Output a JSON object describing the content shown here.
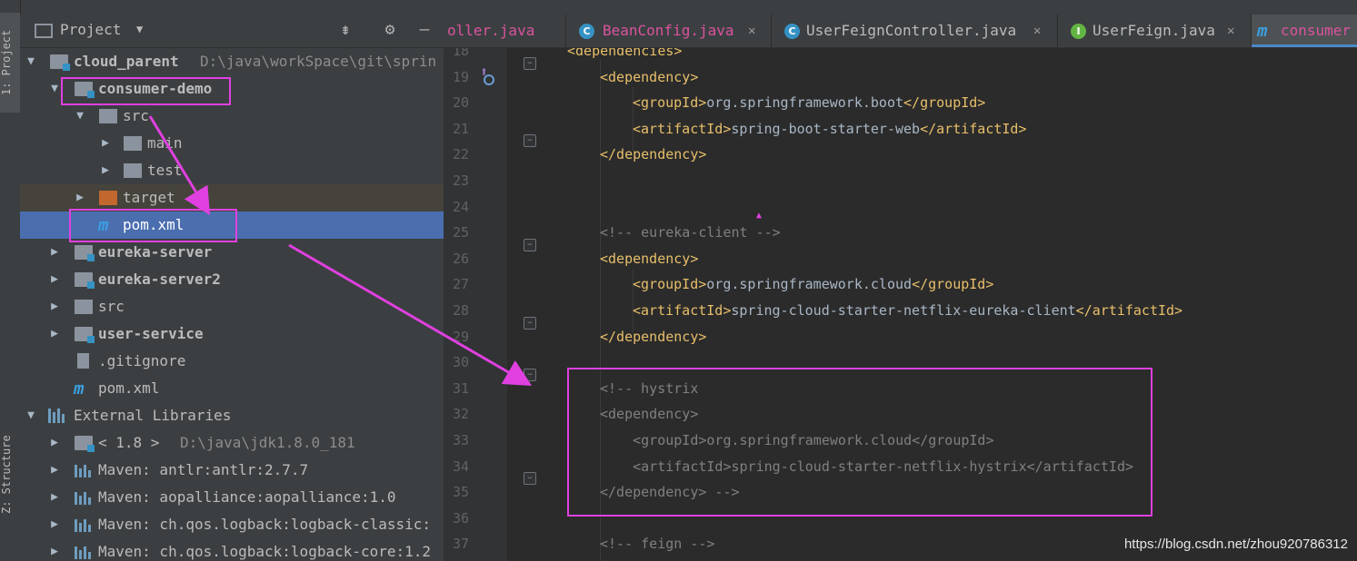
{
  "sidebar": {
    "project_tab": "1: Project",
    "structure_tab": "Z: Structure"
  },
  "project_panel": {
    "title": "Project",
    "tree": [
      {
        "label": "cloud_parent",
        "path": "D:\\java\\workSpace\\git\\sprin",
        "expanded": true
      },
      {
        "label": "consumer-demo",
        "expanded": true
      },
      {
        "label": "src",
        "expanded": true
      },
      {
        "label": "main"
      },
      {
        "label": "test"
      },
      {
        "label": "target"
      },
      {
        "label": "pom.xml"
      },
      {
        "label": "eureka-server"
      },
      {
        "label": "eureka-server2"
      },
      {
        "label": "src"
      },
      {
        "label": "user-service"
      },
      {
        "label": ".gitignore"
      },
      {
        "label": "pom.xml"
      },
      {
        "label": "External Libraries"
      },
      {
        "label": "< 1.8 >",
        "path": "D:\\java\\jdk1.8.0_181"
      },
      {
        "label": "Maven: antlr:antlr:2.7.7"
      },
      {
        "label": "Maven: aopalliance:aopalliance:1.0"
      },
      {
        "label": "Maven: ch.qos.logback:logback-classic:"
      },
      {
        "label": "Maven: ch.qos.logback:logback-core:1.2"
      }
    ]
  },
  "tabs": [
    {
      "label": "oller.java",
      "color": "#d9539e"
    },
    {
      "label": "BeanConfig.java",
      "badge": "C",
      "color": "#d9539e"
    },
    {
      "label": "UserFeignController.java",
      "badge": "C"
    },
    {
      "label": "UserFeign.java",
      "badge": "I"
    },
    {
      "label": "consumer",
      "badge": "m",
      "color": "#d9539e"
    }
  ],
  "editor": {
    "lines": [
      {
        "n": "18",
        "tag_open": "<dependencies>"
      },
      {
        "n": "19",
        "tag_open": "<dependency>"
      },
      {
        "n": "20",
        "open": "<groupId>",
        "text": "org.springframework.boot",
        "close": "</groupId>"
      },
      {
        "n": "21",
        "open": "<artifactId>",
        "text": "spring-boot-starter-web",
        "close": "</artifactId>"
      },
      {
        "n": "22",
        "tag_open": "</dependency>"
      },
      {
        "n": "23"
      },
      {
        "n": "24"
      },
      {
        "n": "25",
        "comment": "<!-- eureka-client -->"
      },
      {
        "n": "26",
        "tag_open": "<dependency>"
      },
      {
        "n": "27",
        "open": "<groupId>",
        "text": "org.springframework.cloud",
        "close": "</groupId>"
      },
      {
        "n": "28",
        "open": "<artifactId>",
        "text": "spring-cloud-starter-netflix-eureka-client",
        "close": "</artifactId>"
      },
      {
        "n": "29",
        "tag_open": "</dependency>"
      },
      {
        "n": "30"
      },
      {
        "n": "31",
        "comment": "<!-- hystrix"
      },
      {
        "n": "32",
        "comment": "<dependency>"
      },
      {
        "n": "33",
        "comment": "    <groupId>org.springframework.cloud</groupId>"
      },
      {
        "n": "34",
        "comment": "    <artifactId>spring-cloud-starter-netflix-hystrix</artifactId>"
      },
      {
        "n": "35",
        "comment": "</dependency> -->"
      },
      {
        "n": "36"
      },
      {
        "n": "37",
        "comment": "<!-- feign -->"
      }
    ]
  },
  "watermark": "https://blog.csdn.net/zhou920786312",
  "colors": {
    "annotation": "#e040e0",
    "selection": "#4b6eaf",
    "tag": "#e8bf6a",
    "comment": "#808080"
  }
}
